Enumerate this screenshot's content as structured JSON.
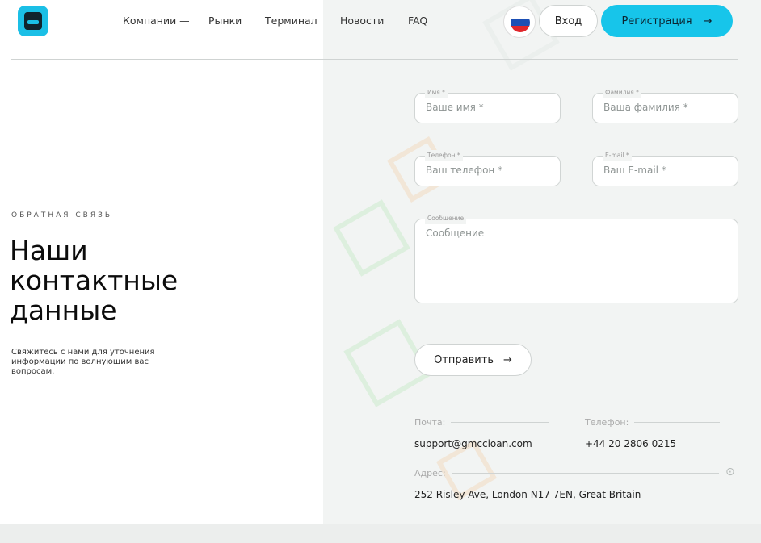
{
  "header": {
    "nav": [
      "Компании —",
      "Рынки",
      "Терминал",
      "Новости",
      "FAQ"
    ],
    "login_label": "Вход",
    "register_label": "Регистрация",
    "register_arrow": "→"
  },
  "hero": {
    "eyebrow": "ОБРАТНАЯ СВЯЗЬ",
    "title_line1": "Наши",
    "title_line2": "контактные",
    "title_line3": "данные",
    "subtitle": "Свяжитесь с нами для уточнения информации по волнующим вас вопросам."
  },
  "form": {
    "name": {
      "legend": "Имя *",
      "placeholder": "Ваше имя *"
    },
    "surname": {
      "legend": "Фамилия *",
      "placeholder": "Ваша фамилия *"
    },
    "phone": {
      "legend": "Телефон *",
      "placeholder": "Ваш телефон *"
    },
    "email": {
      "legend": "E-mail *",
      "placeholder": "Ваш E-mail *"
    },
    "message": {
      "legend": "Сообщение",
      "placeholder": "Сообщение"
    },
    "submit_label": "Отправить",
    "submit_arrow": "→"
  },
  "contacts": {
    "mail_label": "Почта:",
    "mail_value": "support@gmccioan.com",
    "phone_label": "Телефон:",
    "phone_value": "+44 20 2806 0215",
    "address_label": "Адрес:",
    "address_value": "252 Risley Ave, London N17 7EN, Great Britain"
  },
  "colors": {
    "accent": "#17c5ea",
    "flag_white": "#ffffff",
    "flag_blue": "#1c4fb5",
    "flag_red": "#e0262b"
  },
  "icons": [
    "logo-icon",
    "russia-flag-icon",
    "mail-icon",
    "phone-icon",
    "location-pin-icon",
    "arrow-right-icon"
  ]
}
